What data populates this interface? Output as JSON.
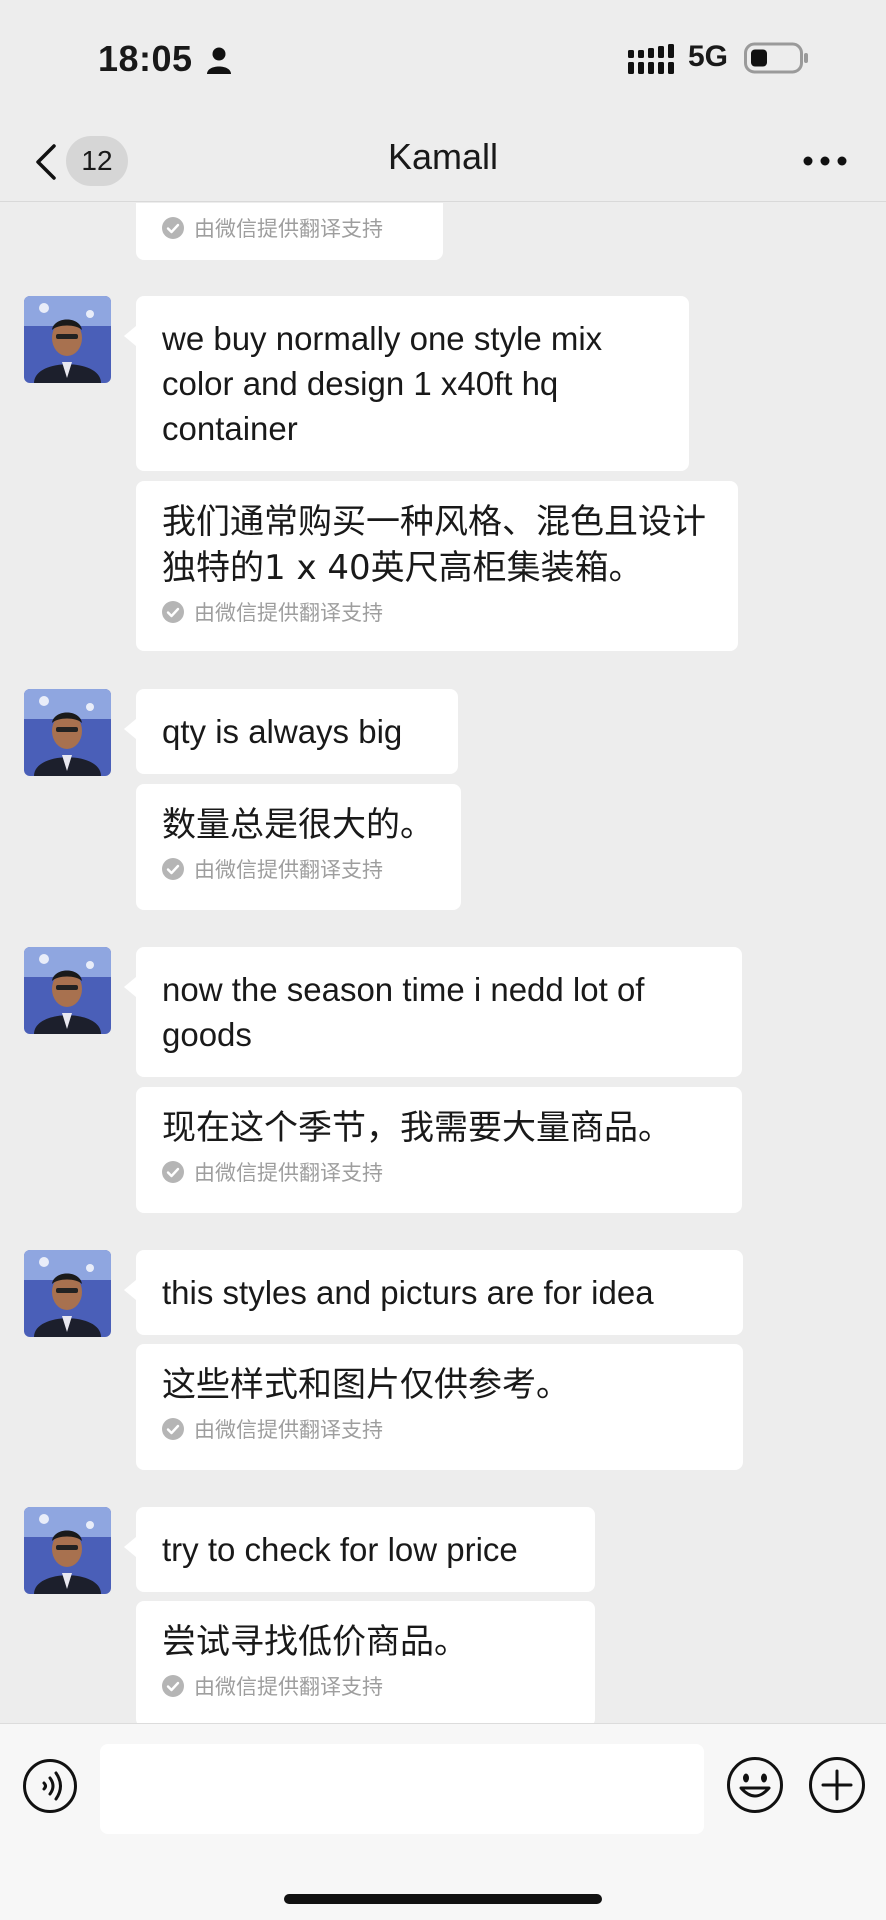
{
  "status_bar": {
    "time": "18:05",
    "network": "5G"
  },
  "nav": {
    "unread_count": "12",
    "title": "Kamall"
  },
  "translation_credit": "由微信提供翻译支持",
  "messages": [
    {
      "text": "we buy normally one style mix\ncolor and design 1 x40ft hq\ncontainer",
      "translation": "我们通常购买一种风格、混色且设计独特的1 x 40英尺高柜集装箱。"
    },
    {
      "text": "qty is always big",
      "translation": "数量总是很大的。"
    },
    {
      "text": "now the season time i nedd lot of\ngoods",
      "translation": "现在这个季节，我需要大量商品。"
    },
    {
      "text": "this styles and picturs are for idea",
      "translation": "这些样式和图片仅供参考。"
    },
    {
      "text": "try to check for low price",
      "translation": "尝试寻找低价商品。"
    }
  ],
  "input": {
    "value": ""
  },
  "icons": {
    "person": "person-icon",
    "signal": "cellular-signal-icon",
    "battery": "battery-icon",
    "back": "chevron-left-icon",
    "more": "more-dots-icon",
    "voice": "voice-icon",
    "emoji": "emoji-icon",
    "plus": "plus-icon",
    "check": "check-circle-icon"
  }
}
